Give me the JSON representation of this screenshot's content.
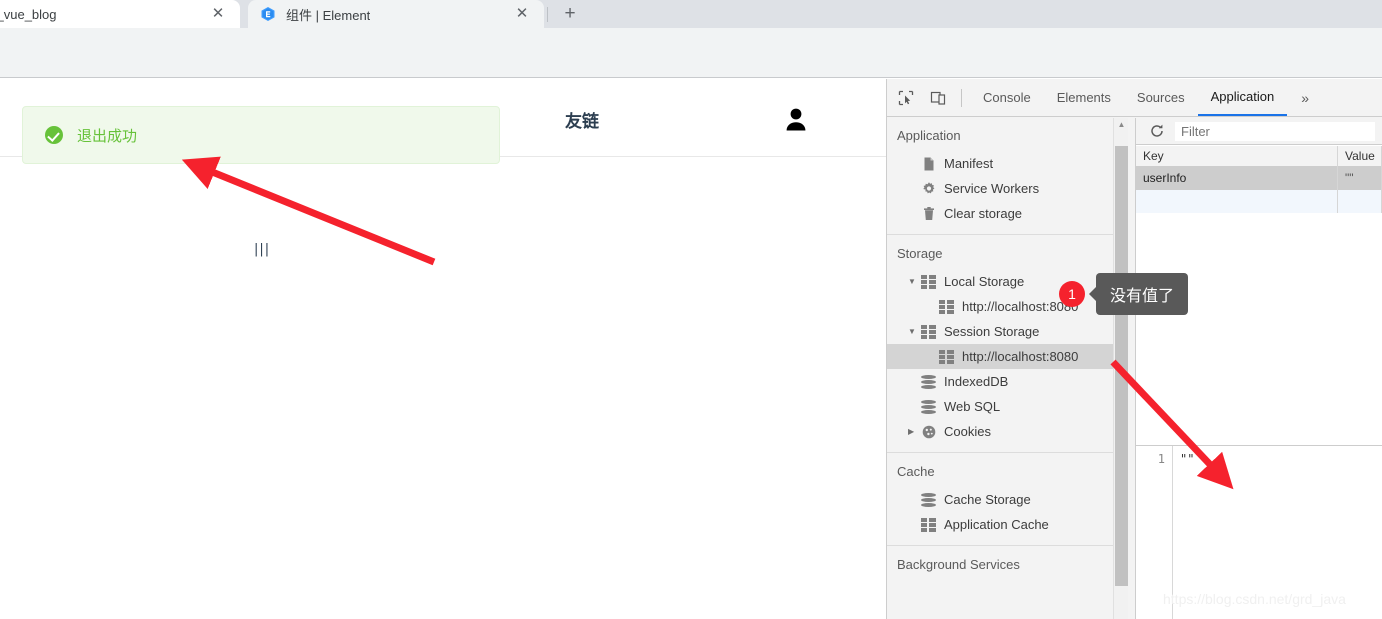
{
  "browser": {
    "tabs": [
      {
        "title": "y_vue_blog",
        "favicon": "none",
        "active": false,
        "close_label": "✕"
      },
      {
        "title": "组件 | Element",
        "favicon": "element-ui-icon",
        "active": true,
        "close_label": "✕"
      }
    ],
    "new_tab_label": "+"
  },
  "page": {
    "nav_link": "友链",
    "avatar_icon": "person-icon",
    "ghost_text": "|||",
    "toast": {
      "icon": "success-check-icon",
      "message": "退出成功",
      "bg_color": "#f0f9eb",
      "border_color": "#e1f3d8",
      "accent_color": "#67c23a"
    }
  },
  "devtools": {
    "toolbar": {
      "inspect_icon": "inspect-element-icon",
      "device_icon": "device-toolbar-icon",
      "more_label": "»"
    },
    "tabs": [
      {
        "label": "Console",
        "active": false
      },
      {
        "label": "Elements",
        "active": false
      },
      {
        "label": "Sources",
        "active": false
      },
      {
        "label": "Application",
        "active": true
      }
    ],
    "active_tab_underline_color": "#1a73e8",
    "sidebar": {
      "sections": [
        {
          "title": "Application",
          "items": [
            {
              "label": "Manifest",
              "icon": "document-icon",
              "indent": 1,
              "arrow": "",
              "selected": false
            },
            {
              "label": "Service Workers",
              "icon": "gear-icon",
              "indent": 1,
              "arrow": "",
              "selected": false
            },
            {
              "label": "Clear storage",
              "icon": "trash-icon",
              "indent": 1,
              "arrow": "",
              "selected": false
            }
          ]
        },
        {
          "title": "Storage",
          "items": [
            {
              "label": "Local Storage",
              "icon": "grid-icon",
              "indent": 1,
              "arrow": "▼",
              "selected": false
            },
            {
              "label": "http://localhost:8080",
              "icon": "grid-icon",
              "indent": 2,
              "arrow": "",
              "selected": false
            },
            {
              "label": "Session Storage",
              "icon": "grid-icon",
              "indent": 1,
              "arrow": "▼",
              "selected": false
            },
            {
              "label": "http://localhost:8080",
              "icon": "grid-icon",
              "indent": 2,
              "arrow": "",
              "selected": true
            },
            {
              "label": "IndexedDB",
              "icon": "database-icon",
              "indent": 1,
              "arrow": "",
              "selected": false
            },
            {
              "label": "Web SQL",
              "icon": "database-icon",
              "indent": 1,
              "arrow": "",
              "selected": false
            },
            {
              "label": "Cookies",
              "icon": "cookie-icon",
              "indent": 1,
              "arrow": "▶",
              "selected": false
            }
          ]
        },
        {
          "title": "Cache",
          "items": [
            {
              "label": "Cache Storage",
              "icon": "database-icon",
              "indent": 1,
              "arrow": "",
              "selected": false
            },
            {
              "label": "Application Cache",
              "icon": "grid-icon",
              "indent": 1,
              "arrow": "",
              "selected": false
            }
          ]
        },
        {
          "title": "Background Services",
          "items": []
        }
      ]
    },
    "storage_panel": {
      "refresh_icon": "refresh-icon",
      "filter_placeholder": "Filter",
      "filter_value": "",
      "columns": [
        "Key",
        "Value"
      ],
      "rows": [
        {
          "key": "userInfo",
          "value": "\"\"",
          "selected": true
        },
        {
          "key": "",
          "value": "",
          "selected": false
        }
      ]
    },
    "preview": {
      "line_number": "1",
      "content": "\"\""
    }
  },
  "annotations": {
    "badge": "1",
    "callout_text": "没有值了",
    "callout_bg": "#595959",
    "badge_bg": "#f5222d",
    "arrow_color": "#f5222d"
  },
  "watermark": "https://blog.csdn.net/grd_java"
}
